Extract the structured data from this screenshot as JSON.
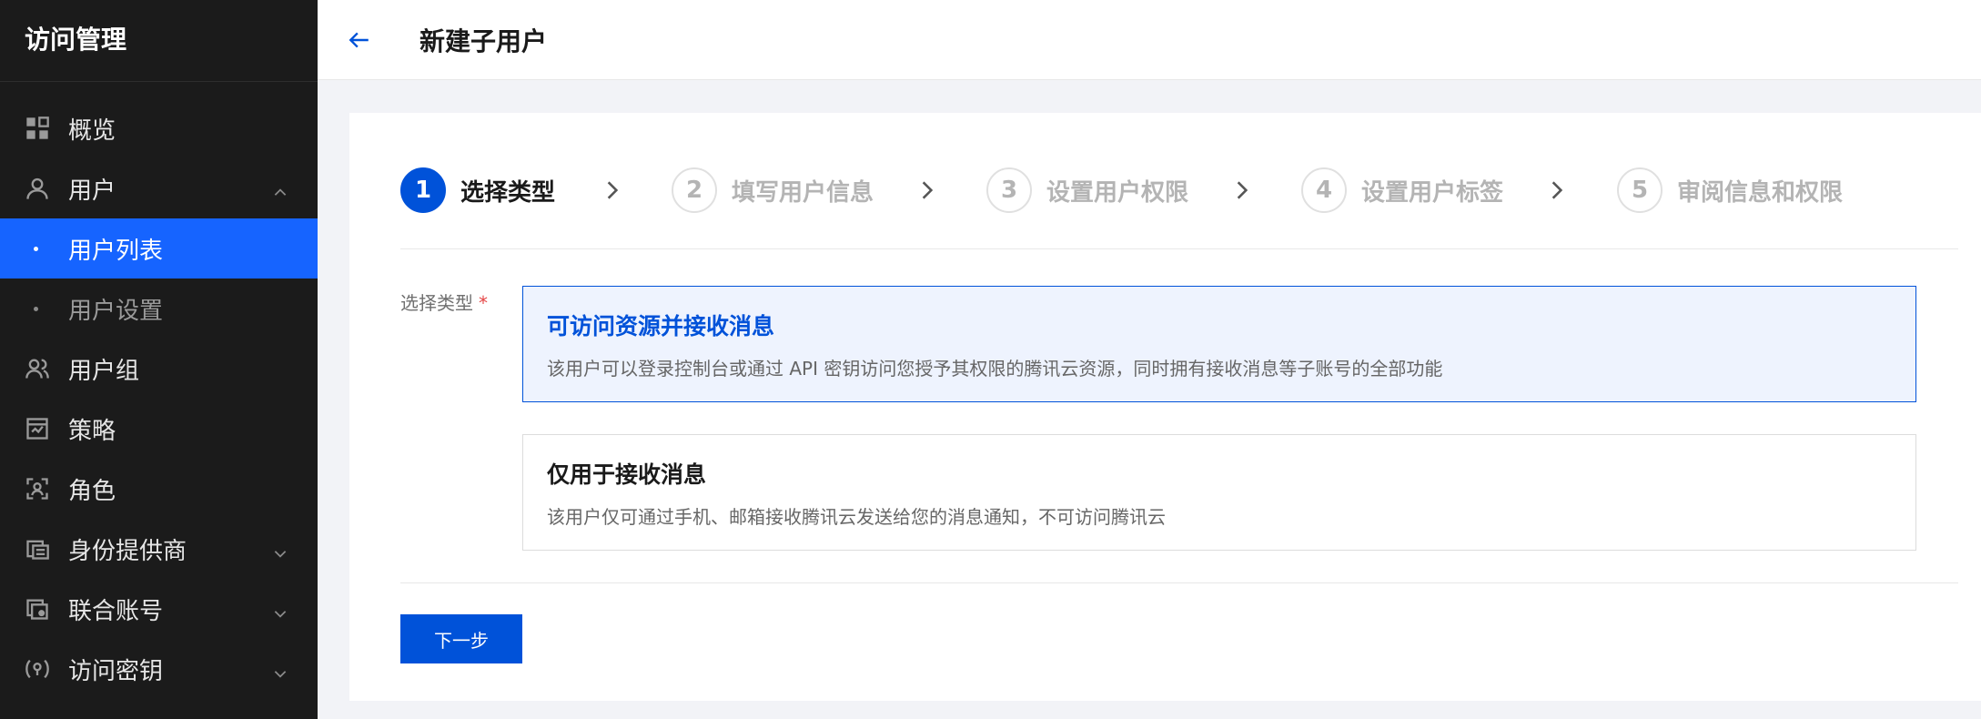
{
  "sidebar": {
    "title": "访问管理",
    "items": [
      {
        "label": "概览",
        "icon": "grid-icon"
      },
      {
        "label": "用户",
        "icon": "user-icon",
        "expanded": true,
        "children": [
          {
            "label": "用户列表",
            "active": true
          },
          {
            "label": "用户设置",
            "active": false
          }
        ]
      },
      {
        "label": "用户组",
        "icon": "user-group-icon"
      },
      {
        "label": "策略",
        "icon": "policy-icon"
      },
      {
        "label": "角色",
        "icon": "role-icon"
      },
      {
        "label": "身份提供商",
        "icon": "identity-provider-icon",
        "expanded": false
      },
      {
        "label": "联合账号",
        "icon": "federated-account-icon",
        "expanded": false
      },
      {
        "label": "访问密钥",
        "icon": "access-key-icon",
        "expanded": false
      }
    ]
  },
  "header": {
    "back_icon": "arrow-left-icon",
    "title": "新建子用户"
  },
  "steps": [
    {
      "num": "1",
      "label": "选择类型",
      "active": true
    },
    {
      "num": "2",
      "label": "填写用户信息",
      "active": false
    },
    {
      "num": "3",
      "label": "设置用户权限",
      "active": false
    },
    {
      "num": "4",
      "label": "设置用户标签",
      "active": false
    },
    {
      "num": "5",
      "label": "审阅信息和权限",
      "active": false
    }
  ],
  "form": {
    "label": "选择类型",
    "required_mark": "*",
    "options": [
      {
        "title": "可访问资源并接收消息",
        "desc": "该用户可以登录控制台或通过 API 密钥访问您授予其权限的腾讯云资源，同时拥有接收消息等子账号的全部功能",
        "selected": true
      },
      {
        "title": "仅用于接收消息",
        "desc": "该用户仅可通过手机、邮箱接收腾讯云发送给您的消息通知，不可访问腾讯云",
        "selected": false
      }
    ]
  },
  "actions": {
    "next_label": "下一步"
  },
  "colors": {
    "primary": "#0052d9",
    "sidebar_bg": "#1b1b1b",
    "sidebar_active": "#1664ff",
    "selected_bg": "#eef3fe",
    "required": "#e54545"
  }
}
